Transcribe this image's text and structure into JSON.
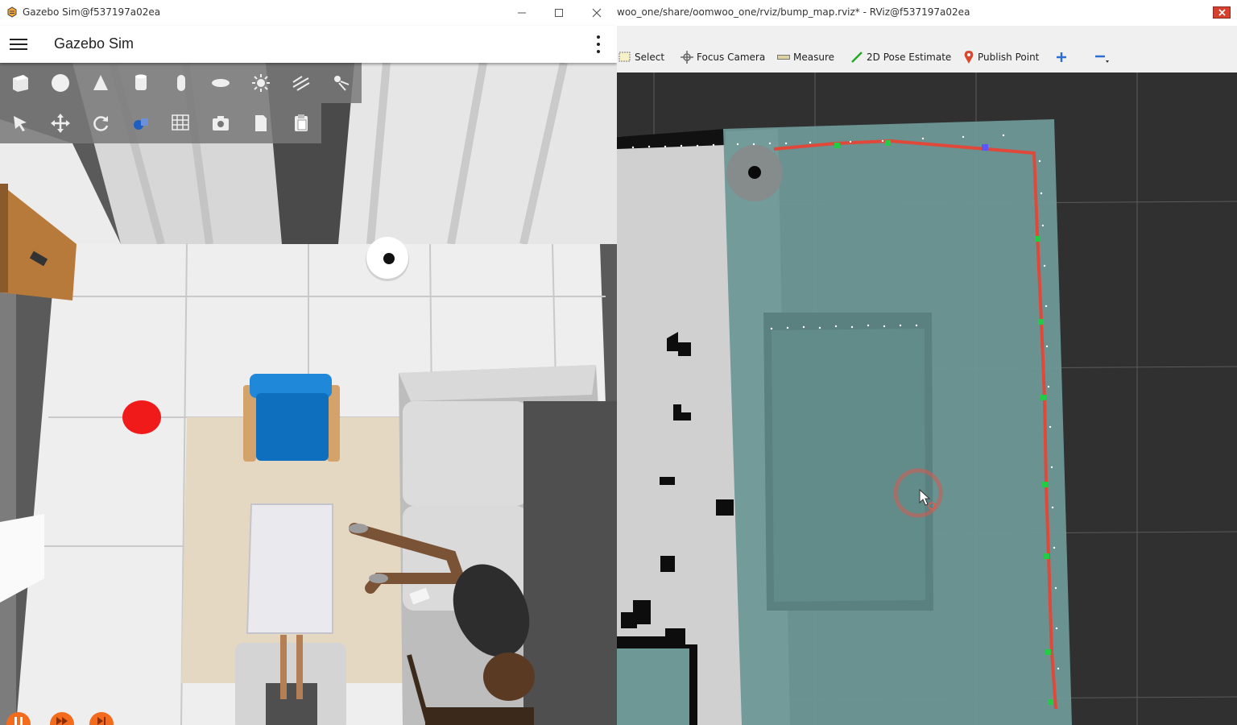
{
  "gazebo": {
    "window_title": "Gazebo Sim@f537197a02ea",
    "app_title": "Gazebo Sim",
    "shape_tools": [
      "box-icon",
      "sphere-icon",
      "cone-icon",
      "cylinder-icon",
      "capsule-icon",
      "ellipsoid-icon",
      "sun-light-icon",
      "directional-light-icon",
      "spot-light-icon"
    ],
    "transform_tools": [
      "select-arrow-icon",
      "translate-icon",
      "rotate-icon",
      "transform-control-icon",
      "grid-snap-icon",
      "screenshot-icon",
      "copy-icon",
      "paste-icon"
    ],
    "playback": [
      "pause-icon",
      "step-icon",
      "fast-forward-icon"
    ]
  },
  "rviz": {
    "window_title": "woo_one/share/oomwoo_one/rviz/bump_map.rviz* - RViz@f537197a02ea",
    "tools": [
      {
        "label": "Select",
        "icon": "select-icon"
      },
      {
        "label": "Focus Camera",
        "icon": "focus-camera-icon"
      },
      {
        "label": "Measure",
        "icon": "measure-icon"
      },
      {
        "label": "2D Pose Estimate",
        "icon": "pose-estimate-icon"
      },
      {
        "label": "Publish Point",
        "icon": "publish-point-icon"
      }
    ],
    "extra_tools": [
      "add-tool-icon",
      "remove-tool-icon"
    ]
  },
  "colors": {
    "gazebo_accent": "#f36b1c",
    "laser_line": "#e0483a",
    "costmap": "#6e9a98",
    "rviz_background": "#2f2f2f"
  }
}
